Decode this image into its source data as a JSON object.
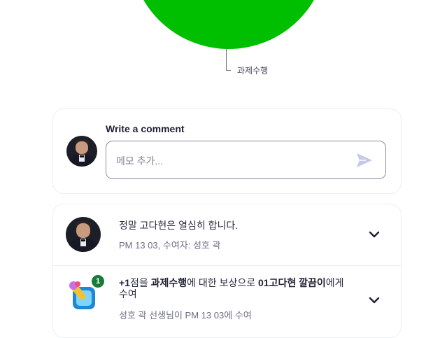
{
  "pie": {
    "label": "과제수행",
    "color": "#00bf00"
  },
  "comment_box": {
    "title": "Write a comment",
    "placeholder": "메모 추가..."
  },
  "feed": [
    {
      "message": "정말 고다현은 열심히 합니다.",
      "meta": "PM 13 03, 수여자: 성호 곽"
    },
    {
      "badge_count": "1",
      "reward": {
        "points": "+1",
        "part1": "점을 ",
        "category": "과제수행",
        "part2": "에 대한 보상으로 ",
        "student": "01고다현 깔끔이",
        "part3": "에게 수여"
      },
      "meta": "성호 곽 선생님이 PM 13 03에 수여"
    }
  ],
  "colors": {
    "accent": "#00bf00",
    "send_icon": "#c5c8e8",
    "badge": "#1b7a3a"
  }
}
